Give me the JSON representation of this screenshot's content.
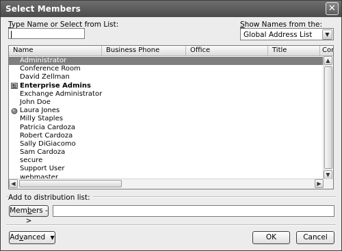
{
  "window": {
    "title": "Select Members",
    "close_glyph": "✕"
  },
  "search": {
    "label_accel": "T",
    "label_rest": "ype Name or Select from List:",
    "value": ""
  },
  "address_book": {
    "label_accel": "S",
    "label_rest": "how Names from the:",
    "selected": "Global Address List",
    "dropdown_glyph": "▼"
  },
  "list": {
    "columns": [
      "Name",
      "Business Phone",
      "Office",
      "Title",
      "Com"
    ],
    "rows": [
      {
        "name": "Administrator",
        "icon": "none"
      },
      {
        "name": "Conference Room",
        "icon": "none"
      },
      {
        "name": "David Zellman",
        "icon": "none"
      },
      {
        "name": "Enterprise Admins",
        "icon": "group-icon"
      },
      {
        "name": "Exchange Administrator",
        "icon": "none"
      },
      {
        "name": "John Doe",
        "icon": "none"
      },
      {
        "name": "Laura Jones",
        "icon": "contact-globe-icon"
      },
      {
        "name": "Milly Staples",
        "icon": "none"
      },
      {
        "name": "Patricia Cardoza",
        "icon": "none"
      },
      {
        "name": "Robert Cardoza",
        "icon": "none"
      },
      {
        "name": "Sally DiGiacomo",
        "icon": "none"
      },
      {
        "name": "Sam Cardoza",
        "icon": "none"
      },
      {
        "name": "secure",
        "icon": "none"
      },
      {
        "name": "Support User",
        "icon": "none"
      },
      {
        "name": "webmaster",
        "icon": "none"
      }
    ],
    "scroll_glyphs": {
      "up": "▲",
      "down": "▼",
      "left": "◀",
      "right": "▶"
    }
  },
  "distribution": {
    "label": "Add to distribution list:",
    "members_accel": "b",
    "members_pre": "Mem",
    "members_post": "ers ->",
    "value": ""
  },
  "footer": {
    "advanced_pre": "Ad",
    "advanced_accel": "v",
    "advanced_post": "anced",
    "advanced_arrow": "▼",
    "ok_label": "OK",
    "cancel_label": "Cancel"
  },
  "colors": {
    "titlebar": "#5a5a5a",
    "selection": "#7f7f7f",
    "dialog_bg": "#ececec"
  }
}
